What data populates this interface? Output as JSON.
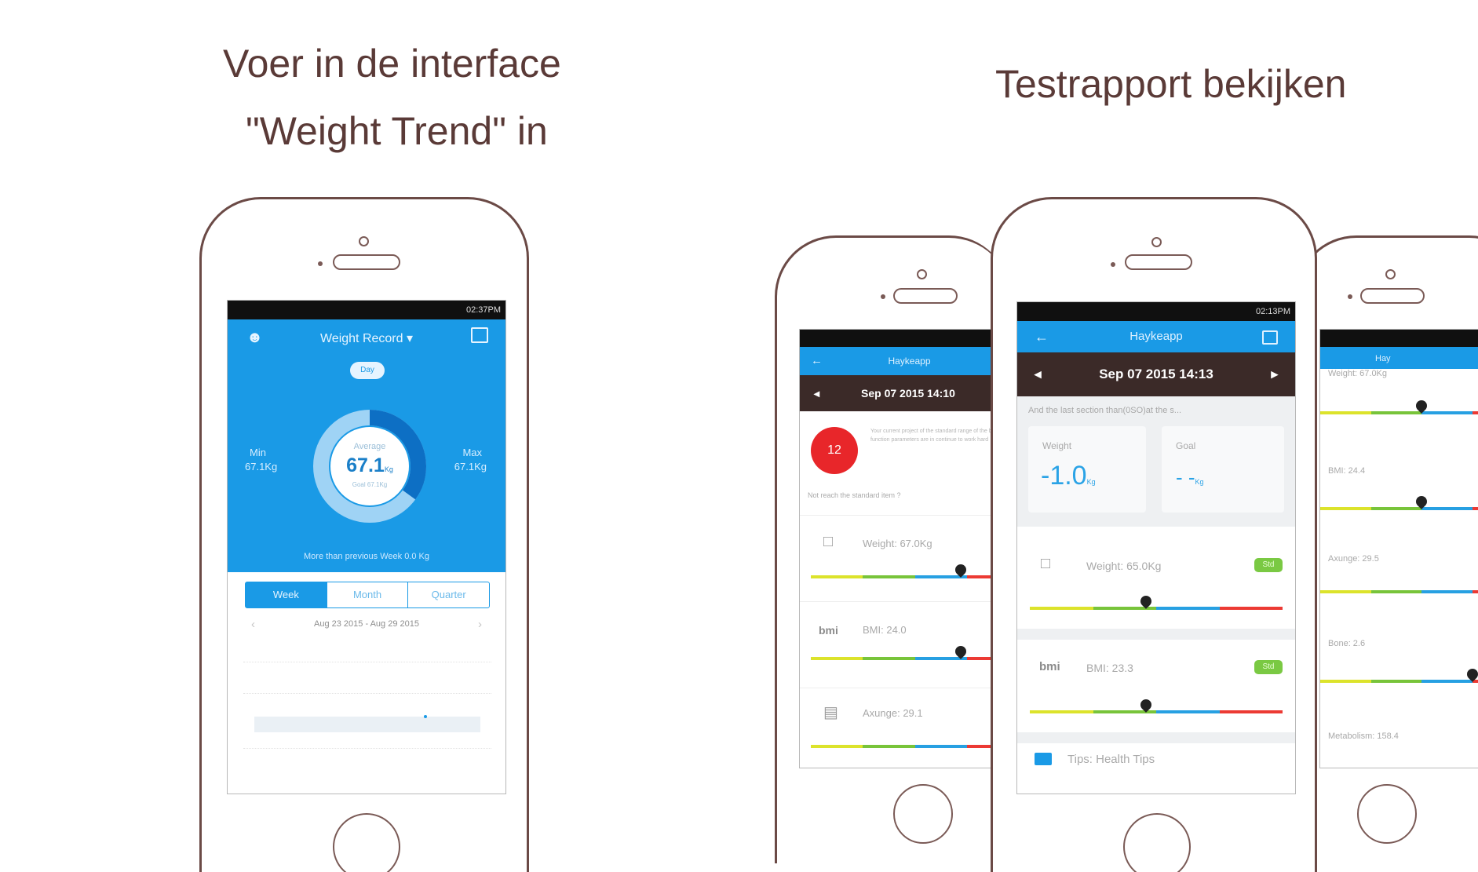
{
  "left_caption": {
    "line1": "Voer in de interface",
    "line2": "\"Weight Trend\" in"
  },
  "right_caption": "Testrapport bekijken",
  "colors": {
    "heading": "#5a3a37",
    "app_blue": "#1a9ae6",
    "phone_outline": "#6b4a46",
    "date_bar": "#3b2a28"
  },
  "phone_left": {
    "status_time": "02:37PM",
    "title": "Weight Record",
    "pill": "Day",
    "min_label": "Min",
    "min_value": "67.1Kg",
    "max_label": "Max",
    "max_value": "67.1Kg",
    "avg_label": "Average",
    "avg_value": "67.1",
    "avg_unit": "Kg",
    "avg_sub": "Goal 67.1Kg",
    "footer": "More than previous Week 0.0 Kg",
    "ring_fill": 0.35,
    "tabs": [
      "Week",
      "Month",
      "Quarter"
    ],
    "active_tab": "Week",
    "date_range": "Aug 23 2015 - Aug 29 2015",
    "prev": "‹",
    "next": "›"
  },
  "phone_back_left": {
    "title": "Haykeapp",
    "date": "Sep 07 2015 14:10",
    "score": "12",
    "score_text": "Your current project of the standard range of the body and function parameters are in continue to work hard",
    "question": "Not reach the standard item ?",
    "rows": [
      {
        "label": "Weight: 67.0Kg",
        "marker": 0.72
      },
      {
        "label": "BMI: 24.0",
        "marker": 0.72
      },
      {
        "label": "Axunge: 29.1",
        "marker": 0.99
      }
    ]
  },
  "phone_center": {
    "status_time": "02:13PM",
    "title": "Haykeapp",
    "date": "Sep 07 2015 14:13",
    "summary": "And the last section than(0SO)at the s...",
    "weight_label": "Weight",
    "weight_value": "-1.0",
    "weight_unit": "Kg",
    "goal_label": "Goal",
    "goal_value": "- -",
    "goal_unit": "Kg",
    "rows": [
      {
        "label": "Weight: 65.0Kg",
        "badge": "Std",
        "marker": 0.46
      },
      {
        "label": "BMI: 23.3",
        "badge": "Std",
        "marker": 0.46
      }
    ],
    "tips": "Tips: Health Tips",
    "prev": "◂",
    "next": "▸"
  },
  "phone_back_right": {
    "title": "Hay",
    "rows": [
      {
        "label": "Weight: 67.0Kg",
        "marker": 0.5
      },
      {
        "label": "BMI: 24.4",
        "marker": 0.5
      },
      {
        "label": "Axunge: 29.5",
        "marker": 0.85
      },
      {
        "label": "Bone: 2.6",
        "marker": 0.75
      },
      {
        "label": "Metabolism: 158.4"
      }
    ]
  }
}
